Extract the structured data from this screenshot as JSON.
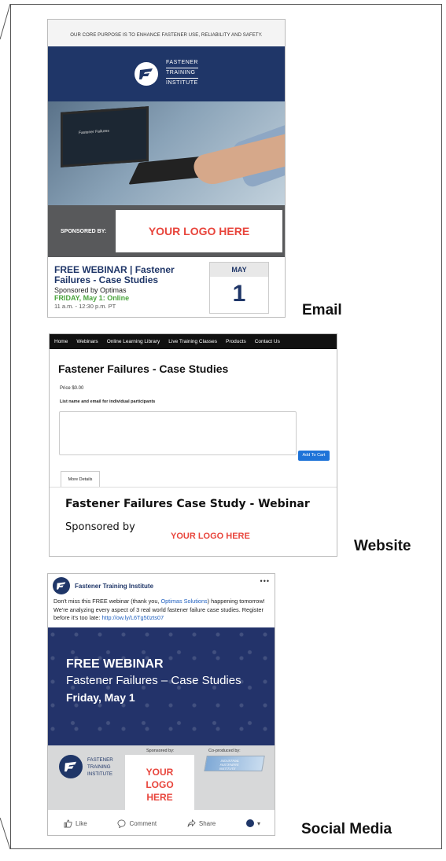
{
  "labels": {
    "email": "Email",
    "website": "Website",
    "social": "Social Media"
  },
  "email": {
    "core_purpose": "OUR CORE PURPOSE IS TO ENHANCE FASTENER USE, RELIABILITY AND SAFETY.",
    "logo_lines": [
      "FASTENER",
      "TRAINING",
      "INSTITUTE"
    ],
    "screen_text": "Fastener Failures",
    "sponsored_by": "SPONSORED BY:",
    "logo_placeholder": "YOUR LOGO HERE",
    "title": "FREE WEBINAR | Fastener Failures - Case Studies",
    "sponsor_line": "Sponsored by Optimas",
    "date_line": "FRIDAY, May 1: Online",
    "time_line": "11 a.m. - 12:30 p.m. PT",
    "month": "MAY",
    "day": "1",
    "colors": {
      "navy": "#1f3668",
      "red": "#e8453c",
      "green": "#4aa43d"
    }
  },
  "website": {
    "nav": [
      "Home",
      "Webinars",
      "Online Learning Library",
      "Live Training Classes",
      "Products",
      "Contact Us"
    ],
    "title": "Fastener Failures - Case Studies",
    "price": "Price $0.00",
    "participants_label": "List name and email for individual participants",
    "add_to_cart": "Add To Cart",
    "tab": "More Details",
    "heading": "Fastener Failures Case Study - Webinar",
    "sponsored_by": "Sponsored by",
    "logo_placeholder": "YOUR LOGO HERE"
  },
  "social": {
    "page_name": "Fastener Training Institute",
    "more": "•••",
    "post_text_1": "Don't miss this FREE webinar (thank you, ",
    "post_link_1": "Optimas Solutions",
    "post_text_2": ") happening tomorrow! We're analyzing every aspect of 3 real world fastener failure case studies. Register before it's too late: ",
    "post_link_2": "http://ow.ly/L6Tg50zts07",
    "banner_1": "FREE WEBINAR",
    "banner_2": "Fastener Failures – Case Studies",
    "banner_3": "Friday, May 1",
    "logo_lines": [
      "FASTENER",
      "TRAINING",
      "INSTITUTE"
    ],
    "sponsored_by": "Sponsored by:",
    "logo_placeholder_lines": [
      "YOUR",
      "LOGO",
      "HERE"
    ],
    "coproduced_by": "Co-produced by:",
    "coproducer_lines": [
      "INDUSTRIAL",
      "FASTENERS",
      "INSTITUTE"
    ],
    "actions": [
      "Like",
      "Comment",
      "Share"
    ]
  }
}
